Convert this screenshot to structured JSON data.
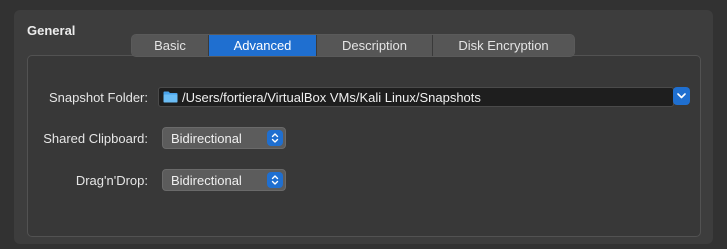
{
  "section": {
    "title": "General"
  },
  "tabs": [
    {
      "label": "Basic",
      "active": false
    },
    {
      "label": "Advanced",
      "active": true
    },
    {
      "label": "Description",
      "active": false
    },
    {
      "label": "Disk Encryption",
      "active": false
    }
  ],
  "snapshot": {
    "label": "Snapshot Folder:",
    "path": "/Users/fortiera/VirtualBox VMs/Kali Linux/Snapshots"
  },
  "clipboard": {
    "label": "Shared Clipboard:",
    "value": "Bidirectional"
  },
  "dragdrop": {
    "label": "Drag'n'Drop:",
    "value": "Bidirectional"
  },
  "colors": {
    "accent": "#1f6fd0",
    "background": "#323232",
    "panel": "#3d3d3d"
  },
  "icons": {
    "folder": "folder-icon",
    "dropdown": "chevron-down-icon",
    "popup": "up-down-arrows-icon"
  }
}
